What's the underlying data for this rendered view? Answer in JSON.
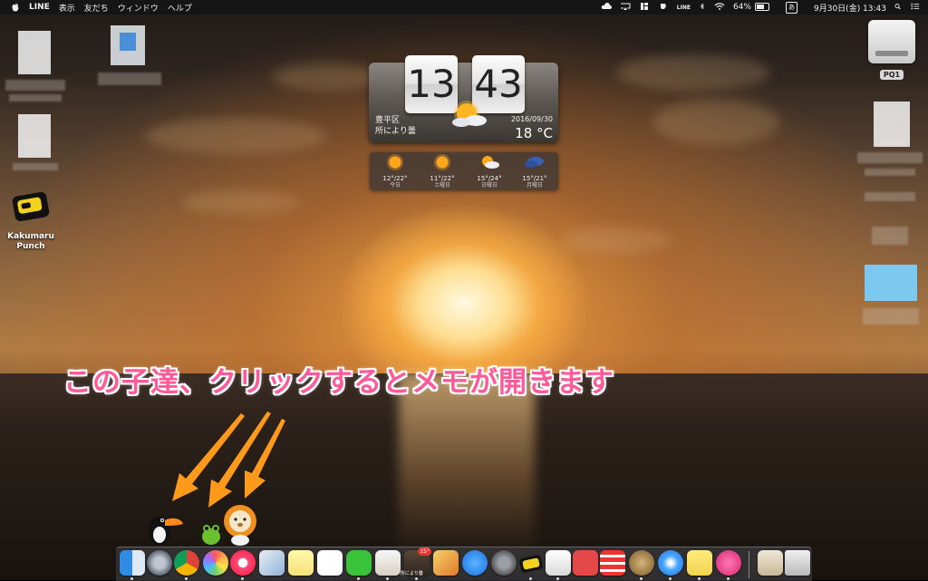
{
  "menubar": {
    "app_name": "LINE",
    "menus": [
      "表示",
      "友だち",
      "ウィンドウ",
      "ヘルプ"
    ],
    "line_status": "LINE",
    "battery": "64%",
    "input_method": "あ",
    "datetime": "9月30日(金)  13:43"
  },
  "desktop": {
    "app_icon_label": "Kakumaru Punch",
    "drive_label": "PQ1"
  },
  "widget": {
    "hour": "13",
    "minute": "43",
    "location": "豊平区",
    "condition": "所により曇",
    "date": "2016/09/30",
    "temperature": "18 °C",
    "forecast": [
      {
        "temp": "12°/22°",
        "label": "今日",
        "icon": "sun-icon"
      },
      {
        "temp": "11°/22°",
        "label": "土曜日",
        "icon": "sun-icon"
      },
      {
        "temp": "15°/24°",
        "label": "日曜日",
        "icon": "sun-cloud-icon"
      },
      {
        "temp": "15°/21°",
        "label": "月曜日",
        "icon": "cloud-icon"
      }
    ]
  },
  "caption": "この子達、クリックするとメモが開きます",
  "dock": {
    "weather_badge": "15°",
    "weather_label": "所により曇"
  },
  "colors": {
    "caption_pink": "#ff5a98",
    "arrow_orange": "#ff9a1a"
  }
}
